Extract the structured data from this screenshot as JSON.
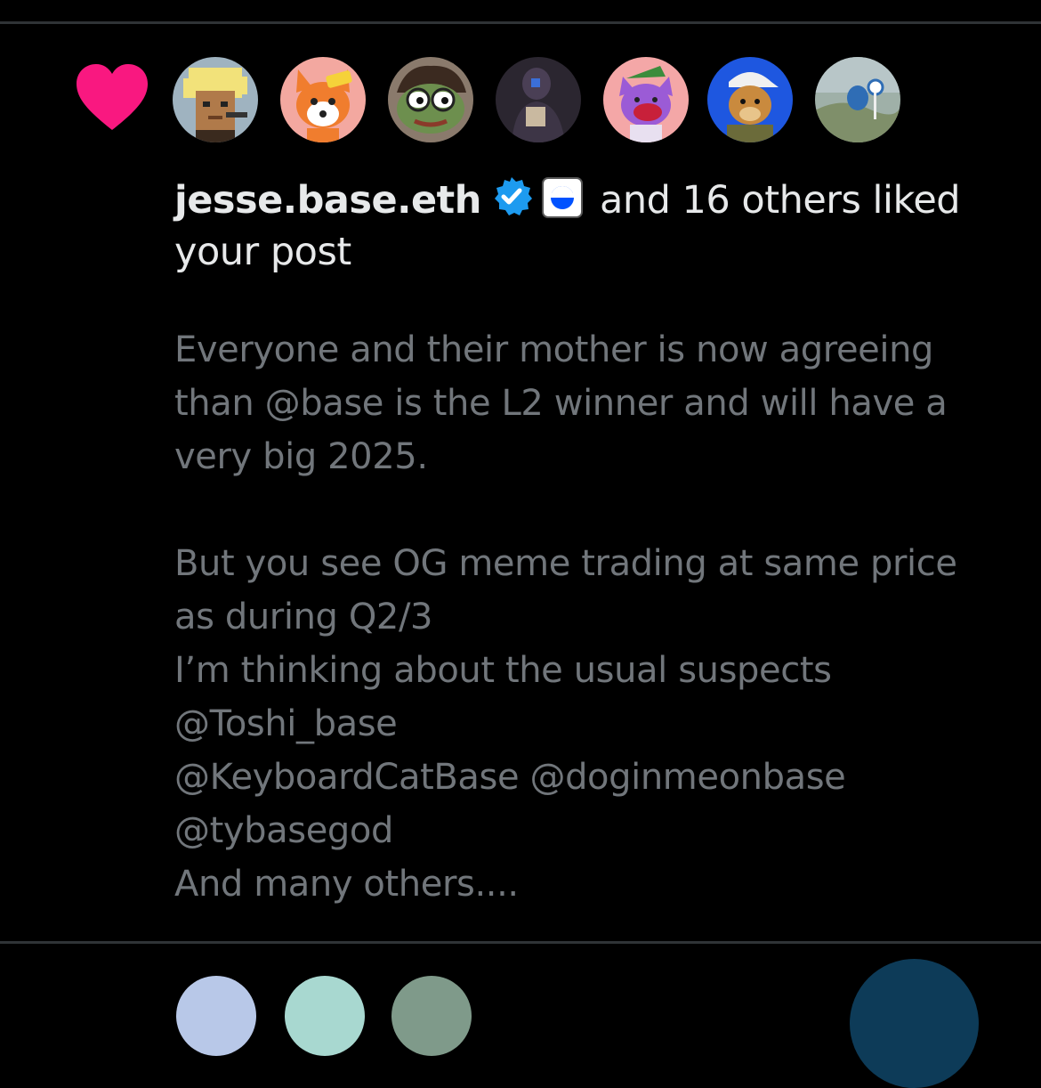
{
  "notification": {
    "type_icon": "heart-icon",
    "heart_color": "#f91880",
    "avatars": [
      {
        "name": "punk-avatar",
        "bg": "#9fb3c0"
      },
      {
        "name": "fox-avatar",
        "bg": "#f3a8a0"
      },
      {
        "name": "pepe-avatar",
        "bg": "#8a7a6c"
      },
      {
        "name": "dark-figure-avatar",
        "bg": "#2b2630"
      },
      {
        "name": "purple-cat-avatar",
        "bg": "#f4a7a7"
      },
      {
        "name": "dog-cap-avatar",
        "bg": "#1e57e0"
      },
      {
        "name": "landscape-avatar",
        "bg": "#9fb0a8"
      }
    ],
    "actor_name": "jesse.base.eth",
    "verified_badge": "verified-badge-icon",
    "verified_color": "#1d9bf0",
    "base_badge": "base-logo-icon",
    "summary_rest": " and 16 others liked",
    "summary_line2": "your post"
  },
  "post": {
    "lines": [
      "Everyone and their mother is now agreeing",
      "than @base is the L2 winner and will have a",
      "very big 2025.",
      "",
      "But you see OG meme trading at same price",
      "as during Q2/3",
      "I’m thinking about the usual suspects",
      "@Toshi_base",
      "@KeyboardCatBase  @doginmeonbase",
      "@tybasegod",
      "And many others...."
    ]
  },
  "colors": {
    "background": "#000000",
    "primary_text": "#e7e9ea",
    "secondary_text": "#71767b",
    "divider": "#2f3336"
  }
}
